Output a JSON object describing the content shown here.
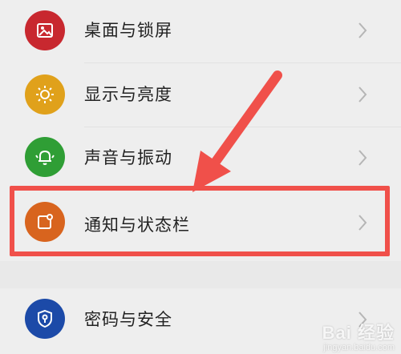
{
  "settings": {
    "items": [
      {
        "label": "桌面与锁屏",
        "icon": "image-icon",
        "color": "#c8282f"
      },
      {
        "label": "显示与亮度",
        "icon": "sun-icon",
        "color": "#e0a11b"
      },
      {
        "label": "声音与振动",
        "icon": "bell-icon",
        "color": "#2f9e35"
      },
      {
        "label": "通知与状态栏",
        "icon": "notification-icon",
        "color": "#d8641e"
      },
      {
        "label": "密码与安全",
        "icon": "shield-icon",
        "color": "#1c4aa8"
      }
    ]
  },
  "annotation": {
    "color": "#f0504a",
    "highlighted_item": "通知与状态栏"
  },
  "watermark": {
    "brand": "Bai 经验",
    "url": "jingyan.baidu.com"
  }
}
